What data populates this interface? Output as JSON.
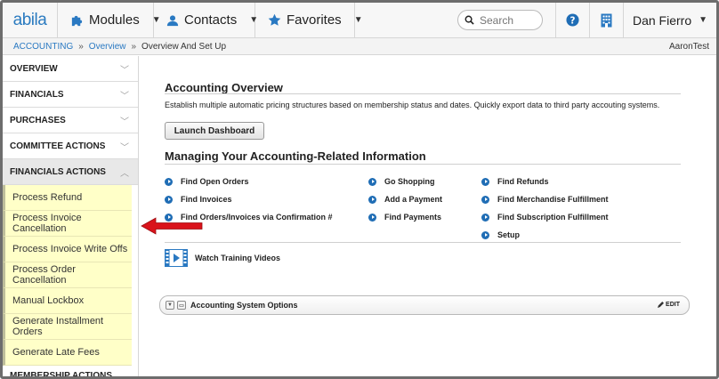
{
  "topnav": {
    "logo": "abila",
    "modules": "Modules",
    "contacts": "Contacts",
    "favorites": "Favorites",
    "search_placeholder": "Search",
    "user": "Dan Fierro"
  },
  "breadcrumb": {
    "items": [
      "ACCOUNTING",
      "Overview",
      "Overview And Set Up"
    ],
    "tenant": "AaronTest"
  },
  "sidebar": {
    "sections_top": [
      "OVERVIEW",
      "FINANCIALS",
      "PURCHASES",
      "COMMITTEE ACTIONS"
    ],
    "active_section": "FINANCIALS ACTIONS",
    "active_items": [
      "Process Refund",
      "Process Invoice Cancellation",
      "Process Invoice Write Offs",
      "Process Order Cancellation",
      "Manual Lockbox",
      "Generate Installment Orders",
      "Generate Late Fees"
    ],
    "next_section": "MEMBERSHIP ACTIONS"
  },
  "main": {
    "overview_title": "Accounting Overview",
    "overview_desc": "Establish multiple automatic pricing structures based on membership status and dates. Quickly export data to third party accouting systems.",
    "launch_button": "Launch Dashboard",
    "managing_title": "Managing Your Accounting-Related Information",
    "links_col1": [
      "Find Open Orders",
      "Find Invoices",
      "Find Orders/Invoices via Confirmation #"
    ],
    "links_col2": [
      "Go Shopping",
      "Add a Payment",
      "Find Payments"
    ],
    "links_col3": [
      "Find Refunds",
      "Find Merchandise Fulfillment",
      "Find Subscription Fulfillment",
      "Setup"
    ],
    "training": "Watch Training Videos",
    "options_panel": "Accounting System Options",
    "edit": "EDIT"
  },
  "colors": {
    "accent": "#2a79c2",
    "highlight": "#ffffc8",
    "arrow": "#d9131b"
  }
}
